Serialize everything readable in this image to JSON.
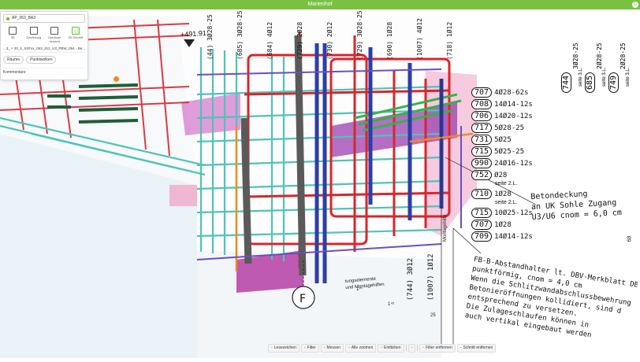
{
  "window": {
    "title": "Marienhof",
    "status_icon": "G"
  },
  "panel": {
    "model": "AP_063_BA3",
    "views": [
      {
        "label": "3D",
        "icon": "cube-icon"
      },
      {
        "label": "Zeichnung",
        "icon": "drawing-icon"
      },
      {
        "label": "Gebäude Ansicht",
        "icon": "building-icon"
      },
      {
        "label": "3D-Schnitt",
        "icon": "section-cube-icon"
      }
    ],
    "path": "...3_ > 30_5_SSFxx_063_312_U3_PBW_064 - Be... (S",
    "chips": [
      "Räume",
      "Punktwolken"
    ],
    "comments": "Kommentare"
  },
  "scene": {
    "level_marker": "+491.91",
    "axis_label": "F",
    "bar_marks_top_left": [
      "(44)",
      "(685)",
      "(684)",
      "(729)",
      "(730)",
      "(729)",
      "(690)",
      "(1007)",
      "(718)"
    ],
    "bar_texts_top_left": [
      "3Ø28-25",
      "3Ø28-25",
      "4Ø12",
      "2Ø28",
      "2Ø12",
      "3Ø28-25",
      "1Ø28",
      "4Ø12",
      "1Ø12"
    ],
    "top_right_marks": [
      {
        "mark": "744",
        "text": "3Ø28-25",
        "sub": "seite 3.L."
      },
      {
        "mark": "685",
        "text": "2Ø28-25",
        "sub": "seite 3.L."
      },
      {
        "mark": "749",
        "text": "2Ø28-25",
        "sub": "seite 3.L."
      }
    ],
    "legend": [
      {
        "mark": "707",
        "text": "4Ø28-62s"
      },
      {
        "mark": "708",
        "text": "14Ø14-12s"
      },
      {
        "mark": "706",
        "text": "14Ø20-12s"
      },
      {
        "mark": "717",
        "text": "5Ø28-25"
      },
      {
        "mark": "731",
        "text": "5Ø25"
      },
      {
        "mark": "715",
        "text": "5Ø25-25"
      },
      {
        "mark": "990",
        "text": "24Ø16-12s"
      },
      {
        "mark": "752",
        "text": "Ø28",
        "sub": "seite 2.L."
      },
      {
        "mark": "710",
        "text": "1Ø28",
        "sub": "seite 2.L."
      },
      {
        "mark": "715",
        "text": "10Ø25-12s"
      },
      {
        "mark": "707",
        "text": "1Ø28"
      },
      {
        "mark": "709",
        "text": "14Ø14-12s"
      }
    ],
    "betondeckung": [
      "Betondeckung",
      "an UK Sohle Zugang",
      "U3/U6 cnom = 6,0 cm"
    ],
    "notes": [
      "FB-B-Abstandhalter lt. DBV-Merkblatt DBV",
      "punktförmig, cnom = 4,0 cm",
      "Wenn die Schlitzwandabschlussbewehrung m",
      "Betonieröffnungen kollidiert, sind d",
      "entsprechend zu versetzen.",
      "Die Zulageschlaufen können in",
      "auch vertikal eingebaut werden"
    ],
    "bottom_marks": [
      {
        "mark": "(744)",
        "text": "3Ø12"
      },
      {
        "mark": "(1007)",
        "text": "1Ø12"
      }
    ],
    "bottom_small": [
      "Montagehilfe",
      "tungselemente",
      "und Montagehilfen"
    ],
    "dims": [
      "1¹⁰",
      "1⁴⁵",
      "25",
      "68"
    ]
  },
  "toolbar": [
    {
      "label": "Lesezeichen",
      "icon": "bookmark-icon"
    },
    {
      "label": "Filter",
      "icon": "filter-icon"
    },
    {
      "label": "Messen",
      "icon": "ruler-icon"
    },
    {
      "label": "Alle zoomen",
      "icon": "zoom-icon"
    },
    {
      "label": "Einfärben",
      "icon": "paint-icon"
    },
    {
      "label": "",
      "icon": "grid-icon"
    },
    {
      "label": "Filter entfernen",
      "icon": "filter-remove-icon"
    },
    {
      "label": "Schnitt entfernen",
      "icon": "section-remove-icon"
    }
  ],
  "colors": {
    "accent": "#7ac143",
    "rebar_red": "#d8262c",
    "rebar_cyan": "#4fc3b8",
    "rebar_blue": "#2b3ea8",
    "magenta": "#b23aa8",
    "green": "#35b34a"
  }
}
